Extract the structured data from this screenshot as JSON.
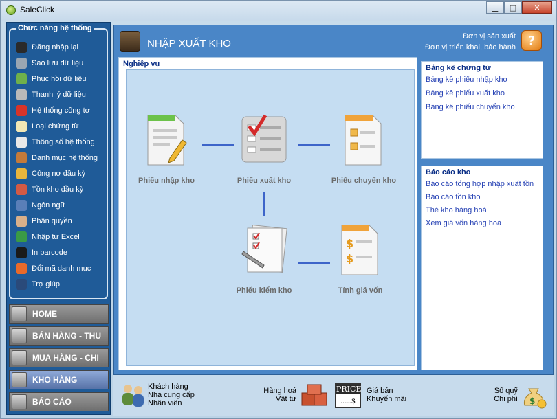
{
  "app": {
    "title": "SaleClick"
  },
  "window_buttons": {
    "minimize": "▁",
    "maximize": "□",
    "close": "✕"
  },
  "sidebar": {
    "menu_title": "Chức năng hệ thống",
    "items": [
      {
        "label": "Đăng nhập lại",
        "icon": "login-icon",
        "color": "#2a2a2a"
      },
      {
        "label": "Sao lưu dữ liệu",
        "icon": "database-backup-icon",
        "color": "#9aa6b2"
      },
      {
        "label": "Phục hồi dữ liệu",
        "icon": "database-restore-icon",
        "color": "#6fb04a"
      },
      {
        "label": "Thanh lý dữ liệu",
        "icon": "database-clean-icon",
        "color": "#b9b9b9"
      },
      {
        "label": "Hệ thống công tơ",
        "icon": "counter-icon",
        "color": "#d8342a"
      },
      {
        "label": "Loại chứng từ",
        "icon": "document-type-icon",
        "color": "#f2e7b5"
      },
      {
        "label": "Thông số hệ thống",
        "icon": "system-params-icon",
        "color": "#e8e8e8"
      },
      {
        "label": "Danh mục hệ thống",
        "icon": "catalog-icon",
        "color": "#c47a3a"
      },
      {
        "label": "Công nợ đầu kỳ",
        "icon": "debt-icon",
        "color": "#e8b53c"
      },
      {
        "label": "Tồn kho đầu kỳ",
        "icon": "opening-stock-icon",
        "color": "#d35a45"
      },
      {
        "label": "Ngôn ngữ",
        "icon": "language-icon",
        "color": "#5a7fb8"
      },
      {
        "label": "Phân quyền",
        "icon": "permission-icon",
        "color": "#d9b08a"
      },
      {
        "label": "Nhập từ Excel",
        "icon": "excel-icon",
        "color": "#3a9a45"
      },
      {
        "label": "In barcode",
        "icon": "barcode-icon",
        "color": "#1a1a1a"
      },
      {
        "label": "Đổi mã danh mục",
        "icon": "swap-code-icon",
        "color": "#e86a2a"
      },
      {
        "label": "Trợ giúp",
        "icon": "help-book-icon",
        "color": "#2a4a7a"
      }
    ],
    "nav": [
      {
        "label": "HOME",
        "icon": "home-icon",
        "active": false
      },
      {
        "label": "BÁN HÀNG - THU",
        "icon": "sales-icon",
        "active": false
      },
      {
        "label": "MUA HÀNG - CHI",
        "icon": "purchase-icon",
        "active": false
      },
      {
        "label": "KHO HÀNG",
        "icon": "warehouse-icon",
        "active": true
      },
      {
        "label": "BÁO CÁO",
        "icon": "report-icon",
        "active": false
      }
    ]
  },
  "header": {
    "title": "NHẬP XUẤT KHO",
    "link1": "Đơn vị sản xuất",
    "link2": "Đơn vị triển khai, bảo hành",
    "help_icon_label": "?"
  },
  "workflow": {
    "title": "Nghiệp vụ",
    "steps": {
      "import": "Phiếu nhập kho",
      "export": "Phiếu xuất kho",
      "transfer": "Phiếu chuyển kho",
      "check": "Phiếu kiểm kho",
      "cost": "Tính giá vốn"
    }
  },
  "lists": {
    "title": "Bảng kê chứng từ",
    "links": [
      "Bảng kê phiếu nhập kho",
      "Bảng kê phiếu xuất kho",
      "Bảng kê phiếu chuyển kho"
    ]
  },
  "reports": {
    "title": "Báo cáo kho",
    "links": [
      "Báo cáo tổng hợp nhập xuất tồn",
      "Báo cáo tồn kho",
      "Thẻ kho hàng hoá",
      "Xem giá vốn hàng hoá"
    ]
  },
  "bottom": {
    "partners": [
      "Khách hàng",
      "Nhà cung cấp",
      "Nhân viên"
    ],
    "goods": [
      "Hàng hoá",
      "Vật tư"
    ],
    "price_tag": "PRICE",
    "price_tag_sub": ".....$",
    "prices": [
      "Giá bán",
      "Khuyến mãi"
    ],
    "funds": [
      "Sổ quỹ",
      "Chi phí"
    ]
  },
  "colors": {
    "accent": "#4a86c7",
    "sidebar": "#1f5b98",
    "link": "#2944b5",
    "connector": "#3d64c9"
  }
}
